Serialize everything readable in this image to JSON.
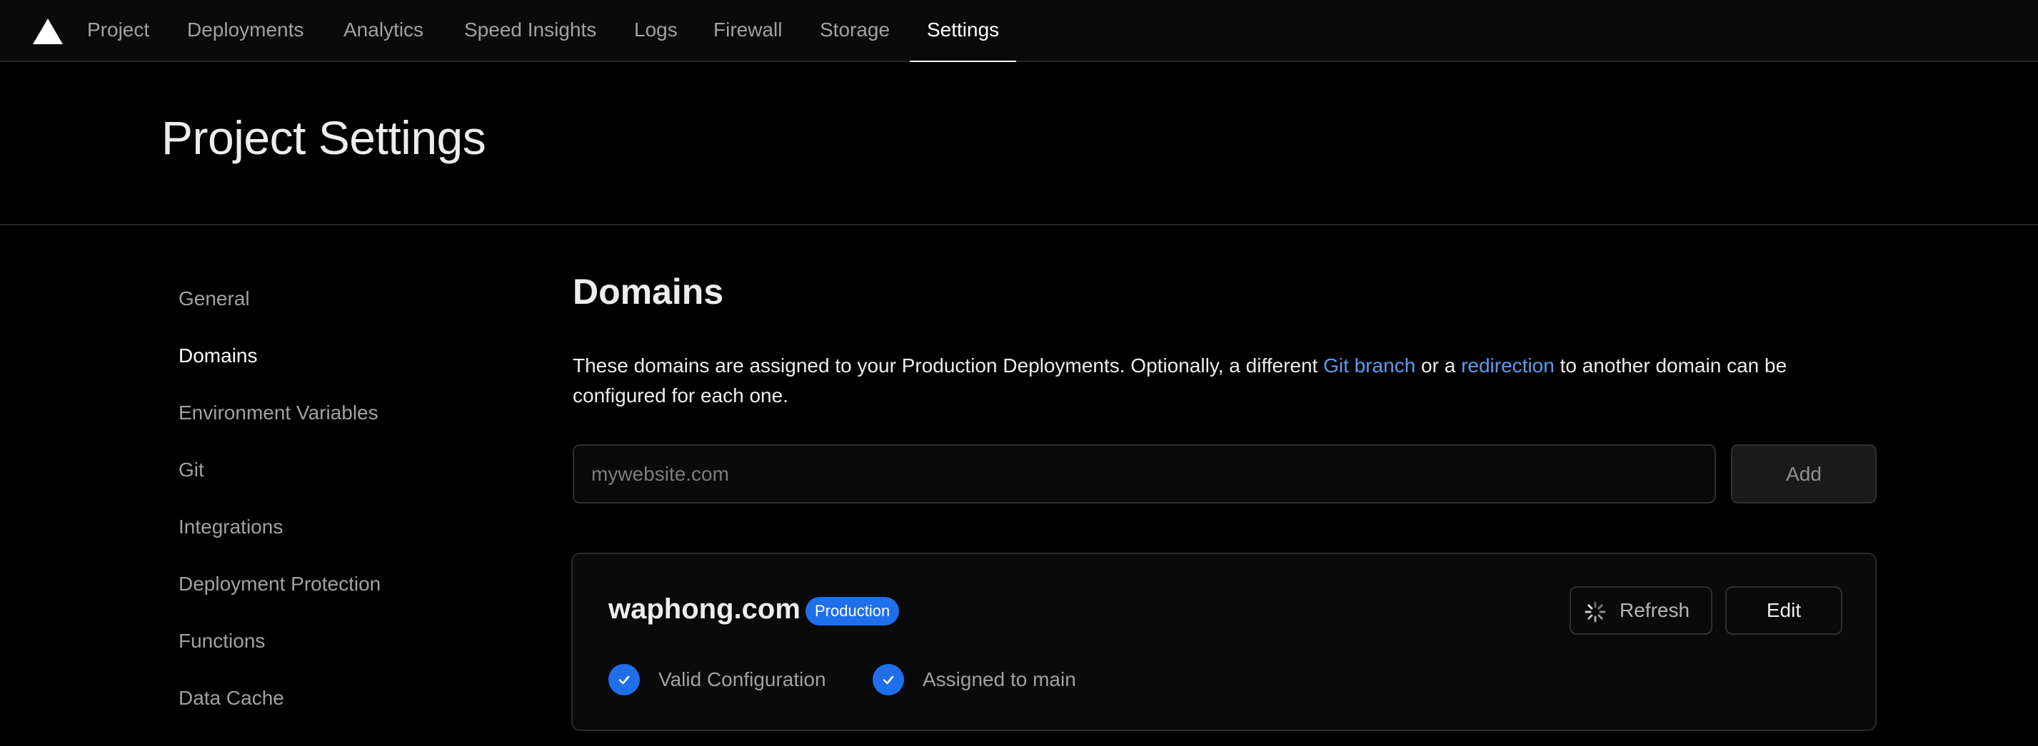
{
  "nav": {
    "tabs": [
      {
        "label": "Project"
      },
      {
        "label": "Deployments"
      },
      {
        "label": "Analytics"
      },
      {
        "label": "Speed Insights"
      },
      {
        "label": "Logs"
      },
      {
        "label": "Firewall"
      },
      {
        "label": "Storage"
      },
      {
        "label": "Settings",
        "active": true
      }
    ]
  },
  "header": {
    "title": "Project Settings"
  },
  "sidebar": {
    "items": [
      {
        "label": "General"
      },
      {
        "label": "Domains",
        "active": true
      },
      {
        "label": "Environment Variables"
      },
      {
        "label": "Git"
      },
      {
        "label": "Integrations"
      },
      {
        "label": "Deployment Protection"
      },
      {
        "label": "Functions"
      },
      {
        "label": "Data Cache"
      }
    ]
  },
  "main": {
    "title": "Domains",
    "description": {
      "part1": "These domains are assigned to your Production Deployments. Optionally, a different ",
      "link1": "Git branch",
      "part2": " or a ",
      "link2": "redirection",
      "part3": " to another domain can be configured for each one."
    },
    "input": {
      "placeholder": "mywebsite.com",
      "value": ""
    },
    "add_label": "Add",
    "domain": {
      "name": "waphong.com",
      "badge": "Production",
      "refresh_label": "Refresh",
      "edit_label": "Edit",
      "statuses": [
        {
          "label": "Valid Configuration",
          "icon": "check-icon"
        },
        {
          "label": "Assigned to main",
          "icon": "check-icon"
        }
      ]
    }
  },
  "colors": {
    "accent": "#1f6feb",
    "link": "#5b9cf5",
    "background": "#000000"
  }
}
